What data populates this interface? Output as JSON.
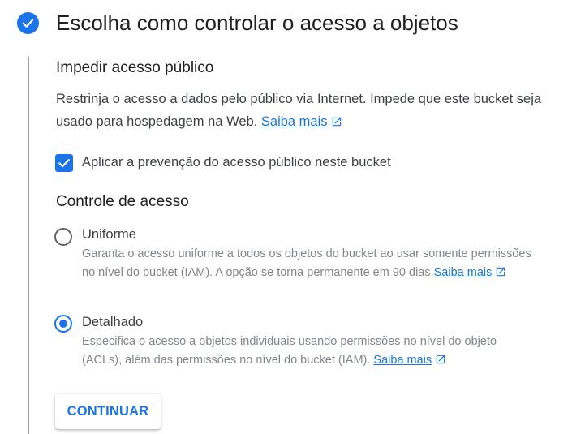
{
  "step": {
    "title": "Escolha como controlar o acesso a objetos",
    "status_icon": "check-circle-icon"
  },
  "public_access": {
    "title": "Impedir acesso público",
    "description": "Restrinja o acesso a dados pelo público via Internet. Impede que este bucket seja usado para hospedagem na Web.",
    "learn_more": "Saiba mais",
    "checkbox_label": "Aplicar a prevenção do acesso público neste bucket",
    "checkbox_checked": true
  },
  "access_control": {
    "title": "Controle de acesso",
    "options": [
      {
        "label": "Uniforme",
        "description": "Garanta o acesso uniforme a todos os objetos do bucket ao usar somente permissões no nível do bucket (IAM). A opção se torna permanente em 90 dias.",
        "learn_more": "Saiba mais",
        "selected": false
      },
      {
        "label": "Detalhado",
        "description": "Especifica o acesso a objetos individuais usando permissões no nível do objeto (ACLs), além das permissões no nível do bucket (IAM).",
        "learn_more": "Saiba mais",
        "selected": true
      }
    ]
  },
  "continue_button": "CONTINUAR",
  "colors": {
    "accent": "#1a73e8",
    "text": "#202124",
    "secondary_text": "#80868b"
  }
}
